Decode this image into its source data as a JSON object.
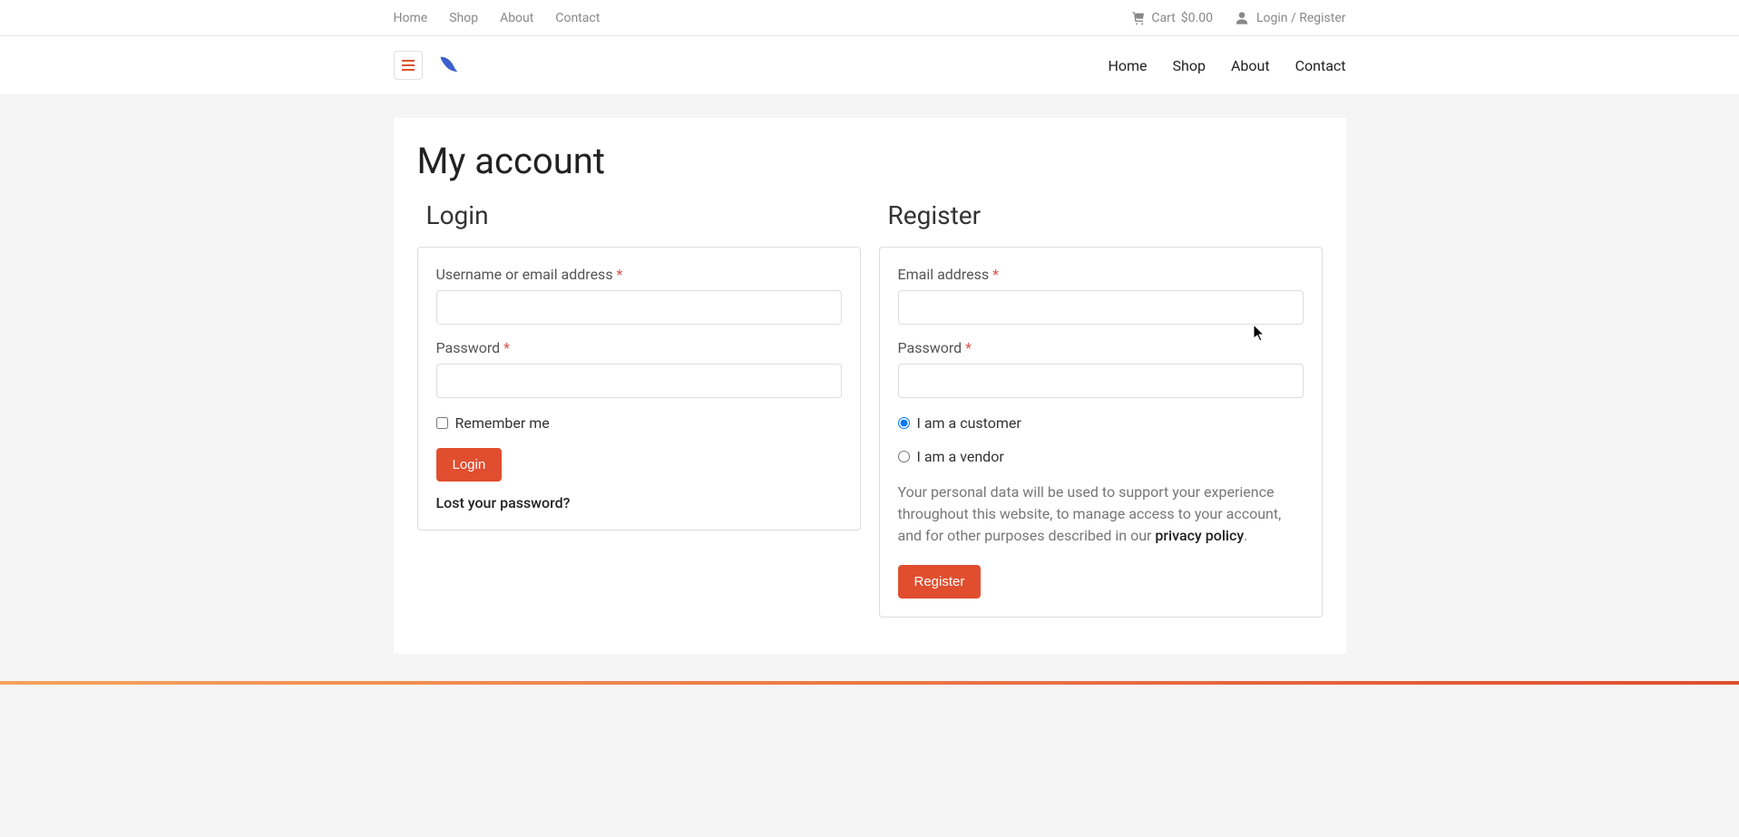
{
  "topNav": {
    "home": "Home",
    "shop": "Shop",
    "about": "About",
    "contact": "Contact"
  },
  "topRight": {
    "cart": "Cart",
    "cartPrice": "$0.00",
    "loginRegister": "Login / Register"
  },
  "mainNav": {
    "home": "Home",
    "shop": "Shop",
    "about": "About",
    "contact": "Contact"
  },
  "page": {
    "title": "My account"
  },
  "login": {
    "heading": "Login",
    "usernameLabel": "Username or email address ",
    "passwordLabel": "Password ",
    "rememberMe": "Remember me",
    "button": "Login",
    "lostPassword": "Lost your password?"
  },
  "register": {
    "heading": "Register",
    "emailLabel": "Email address ",
    "passwordLabel": "Password ",
    "customerOption": "I am a customer",
    "vendorOption": "I am a vendor",
    "privacyText1": "Your personal data will be used to support your experience throughout this website, to manage access to your account, and for other purposes described in our ",
    "privacyLink": "privacy policy",
    "privacyText2": ".",
    "button": "Register"
  },
  "required": "*"
}
